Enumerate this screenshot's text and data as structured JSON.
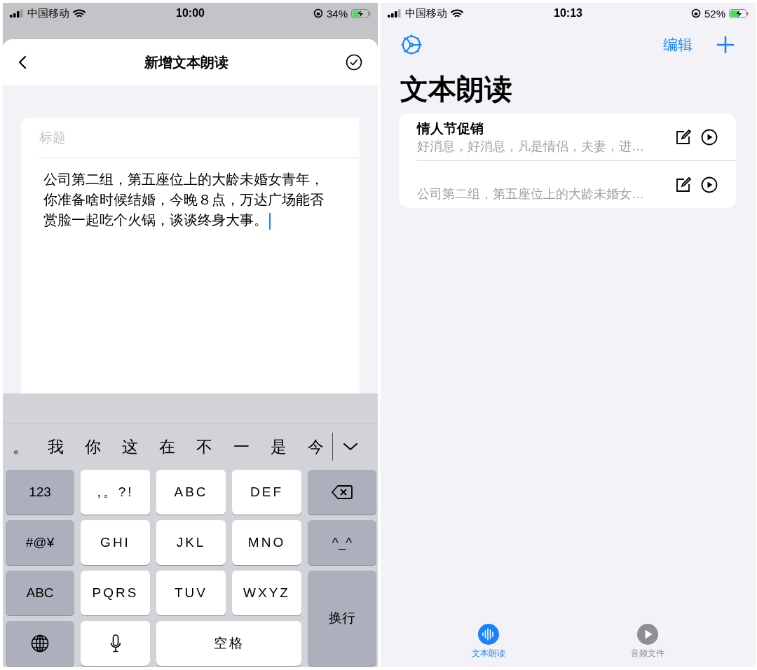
{
  "left_screen": {
    "status_bar": {
      "carrier": "中国移动",
      "time": "10:00",
      "battery": "34%"
    },
    "header": {
      "title": "新增文本朗读"
    },
    "form": {
      "title_placeholder": "标题",
      "body": "公司第二组，第五座位上的大龄未婚女青年，你准备啥时候结婚，今晚８点，万达广场能否赏脸一起吃个火锅，谈谈终身大事。"
    },
    "keyboard": {
      "candidates": [
        "。",
        "我",
        "你",
        "这",
        "在",
        "不",
        "一",
        "是",
        "今"
      ],
      "keys": [
        {
          "kind": "mode",
          "label": "123"
        },
        {
          "kind": "char",
          "label": ",。?!"
        },
        {
          "kind": "char",
          "label": "ABC"
        },
        {
          "kind": "char",
          "label": "DEF"
        },
        {
          "kind": "delete"
        },
        {
          "kind": "mode",
          "label": "#@¥"
        },
        {
          "kind": "char",
          "label": "GHI"
        },
        {
          "kind": "char",
          "label": "JKL"
        },
        {
          "kind": "char",
          "label": "MNO"
        },
        {
          "kind": "mode",
          "label": "^_^"
        },
        {
          "kind": "mode",
          "label": "ABC"
        },
        {
          "kind": "char",
          "label": "PQRS"
        },
        {
          "kind": "char",
          "label": "TUV"
        },
        {
          "kind": "char",
          "label": "WXYZ"
        },
        {
          "kind": "return",
          "label": "换行"
        },
        {
          "kind": "globe"
        },
        {
          "kind": "mic"
        },
        {
          "kind": "space",
          "label": "空格"
        }
      ]
    }
  },
  "right_screen": {
    "status_bar": {
      "carrier": "中国移动",
      "time": "10:13",
      "battery": "52%"
    },
    "nav": {
      "edit": "编辑"
    },
    "title": "文本朗读",
    "items": [
      {
        "title": "情人节促销",
        "preview": "好消息，好消息，凡是情侣，夫妻，进…"
      },
      {
        "preview": "公司第二组，第五座位上的大龄未婚女…"
      }
    ],
    "tabs": [
      {
        "label": "文本朗读",
        "kind": "speech",
        "selected": true
      },
      {
        "label": "音频文件",
        "kind": "play",
        "selected": false
      }
    ]
  }
}
